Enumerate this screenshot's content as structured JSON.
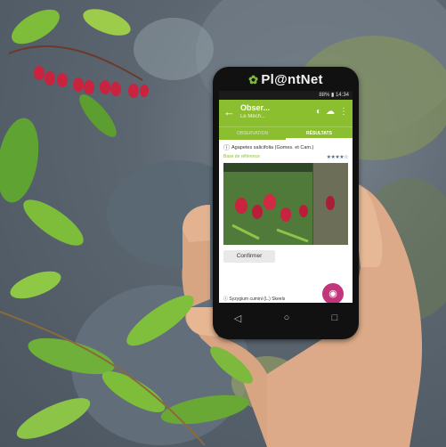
{
  "phone": {
    "brand": "Pl@ntNet",
    "status": "88% ▮ 14:34",
    "app": {
      "back_icon": "arrow-left-icon",
      "title": "Obser...",
      "subtitle": "Le Mêch...",
      "tabs": [
        "OBSERVATION",
        "RÉSULTATS"
      ],
      "active_tab": 1,
      "result1": {
        "name": "Agapetes salicifolia (Gomes. et Cam.)",
        "link": "Base de référence",
        "stars": "★★★★☆"
      },
      "confirm_label": "Confirmer",
      "result2": {
        "name": "Syzygium cumini (L.) Skeels",
        "stars": "★★★★☆"
      },
      "fab_icon": "camera-icon"
    },
    "nav": [
      "◁",
      "○",
      "□"
    ]
  },
  "colors": {
    "accent": "#8cbf2f",
    "fab": "#c2357c",
    "berry": "#c8233f"
  }
}
